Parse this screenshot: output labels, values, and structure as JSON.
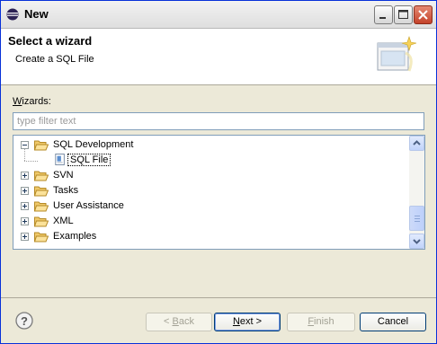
{
  "window": {
    "title": "New"
  },
  "banner": {
    "title": "Select a wizard",
    "description": "Create a SQL File"
  },
  "wizards": {
    "label_mnemonic": "W",
    "label_rest": "izards:",
    "filter_placeholder": "type filter text",
    "tree": [
      {
        "label": "SQL Development",
        "expanded": true,
        "children": [
          {
            "label": "SQL File",
            "selected": true
          }
        ]
      },
      {
        "label": "SVN",
        "expanded": false
      },
      {
        "label": "Tasks",
        "expanded": false
      },
      {
        "label": "User Assistance",
        "expanded": false
      },
      {
        "label": "XML",
        "expanded": false
      },
      {
        "label": "Examples",
        "expanded": false
      }
    ]
  },
  "buttons": {
    "back": {
      "prefix": "< ",
      "mnemonic": "B",
      "rest": "ack"
    },
    "next": {
      "mnemonic": "N",
      "rest": "ext >"
    },
    "finish": {
      "mnemonic": "F",
      "rest": "inish"
    },
    "cancel": {
      "label": "Cancel"
    }
  },
  "colors": {
    "border_accent": "#0831d9",
    "field_border": "#7f9db9",
    "default_button_glow": "#7c9ee8"
  }
}
